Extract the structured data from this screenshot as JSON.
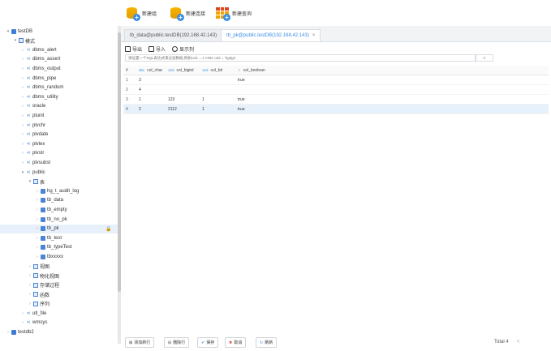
{
  "toolbar": {
    "new_group": "新建组",
    "new_connection": "新建连接",
    "new_query": "新建查询"
  },
  "tree": [
    {
      "label": "testDB",
      "level": 0,
      "icon": "db",
      "arrow": "▾"
    },
    {
      "label": "模式",
      "level": 1,
      "icon": "folder",
      "arrow": "▾"
    },
    {
      "label": "dbms_alert",
      "level": 2,
      "icon": "schema",
      "arrow": "›"
    },
    {
      "label": "dbms_assert",
      "level": 2,
      "icon": "schema",
      "arrow": "›"
    },
    {
      "label": "dbms_output",
      "level": 2,
      "icon": "schema",
      "arrow": "›"
    },
    {
      "label": "dbms_pipe",
      "level": 2,
      "icon": "schema",
      "arrow": "›"
    },
    {
      "label": "dbms_random",
      "level": 2,
      "icon": "schema",
      "arrow": "›"
    },
    {
      "label": "dbms_utility",
      "level": 2,
      "icon": "schema",
      "arrow": "›"
    },
    {
      "label": "oracle",
      "level": 2,
      "icon": "schema",
      "arrow": "›"
    },
    {
      "label": "plunit",
      "level": 2,
      "icon": "schema",
      "arrow": "›"
    },
    {
      "label": "plvchr",
      "level": 2,
      "icon": "schema",
      "arrow": "›"
    },
    {
      "label": "plvdate",
      "level": 2,
      "icon": "schema",
      "arrow": "›"
    },
    {
      "label": "plvlex",
      "level": 2,
      "icon": "schema",
      "arrow": "›"
    },
    {
      "label": "plvstr",
      "level": 2,
      "icon": "schema",
      "arrow": "›"
    },
    {
      "label": "plvsubst",
      "level": 2,
      "icon": "schema",
      "arrow": "›"
    },
    {
      "label": "public",
      "level": 2,
      "icon": "schema",
      "arrow": "▾"
    },
    {
      "label": "表",
      "level": 3,
      "icon": "folder",
      "arrow": "▾"
    },
    {
      "label": "hg_t_audit_log",
      "level": 4,
      "icon": "table",
      "arrow": "›"
    },
    {
      "label": "tb_data",
      "level": 4,
      "icon": "table",
      "arrow": "›"
    },
    {
      "label": "tb_empty",
      "level": 4,
      "icon": "table",
      "arrow": "›"
    },
    {
      "label": "tb_no_pk",
      "level": 4,
      "icon": "table",
      "arrow": "›"
    },
    {
      "label": "tb_pk",
      "level": 4,
      "icon": "table",
      "arrow": "›",
      "selected": true
    },
    {
      "label": "tb_test",
      "level": 4,
      "icon": "table",
      "arrow": "›"
    },
    {
      "label": "tb_typeTest",
      "level": 4,
      "icon": "table",
      "arrow": "›"
    },
    {
      "label": "tbxxxxx",
      "level": 4,
      "icon": "table",
      "arrow": "›"
    },
    {
      "label": "视图",
      "level": 3,
      "icon": "folder",
      "arrow": "›"
    },
    {
      "label": "物化视图",
      "level": 3,
      "icon": "folder",
      "arrow": "›"
    },
    {
      "label": "存储过程",
      "level": 3,
      "icon": "folder",
      "arrow": "›"
    },
    {
      "label": "函数",
      "level": 3,
      "icon": "folder",
      "arrow": "›"
    },
    {
      "label": "序列",
      "level": 3,
      "icon": "folder",
      "arrow": "›"
    },
    {
      "label": "utl_file",
      "level": 2,
      "icon": "schema",
      "arrow": "›"
    },
    {
      "label": "wmsys",
      "level": 2,
      "icon": "schema",
      "arrow": "›"
    },
    {
      "label": "testdb2",
      "level": 0,
      "icon": "db",
      "arrow": "›"
    }
  ],
  "tabs": [
    {
      "label": "tb_data@public.testDB(192.168.42.143)",
      "active": false
    },
    {
      "label": "tb_pk@public.testDB(192.168.42.143)",
      "active": true,
      "close": "×"
    }
  ],
  "actions": {
    "export": "导出",
    "import": "导入",
    "show_columns": "显示列"
  },
  "filter": {
    "placeholder": "请设置一个SQL表达式来过滤数据,例如col1 = 1 AND col2 = 'hgdgs'"
  },
  "grid": {
    "columns": [
      {
        "name": "col_char",
        "icon": "abc"
      },
      {
        "name": "col_bigint",
        "icon": "123"
      },
      {
        "name": "col_bit",
        "icon": "123"
      },
      {
        "name": "col_boolean",
        "icon": "✓"
      }
    ],
    "rows": [
      {
        "n": "1",
        "cells": [
          "3",
          "",
          "",
          "true"
        ]
      },
      {
        "n": "2",
        "cells": [
          "4",
          "",
          "",
          ""
        ]
      },
      {
        "n": "3",
        "cells": [
          "1",
          "123",
          "1",
          "true"
        ]
      },
      {
        "n": "4",
        "cells": [
          "2",
          "2112",
          "1",
          "true"
        ],
        "selected": true
      }
    ]
  },
  "bottom": {
    "add_row": "添加新行",
    "delete_row": "删除行",
    "save": "保存",
    "cancel": "取消",
    "refresh": "刷新",
    "total": "Total 4",
    "pager": "<"
  }
}
